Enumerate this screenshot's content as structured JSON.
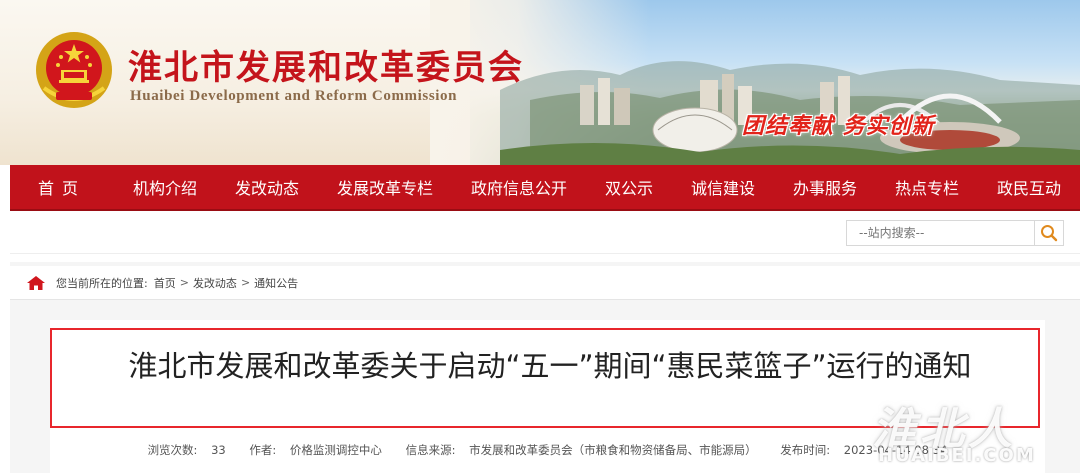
{
  "header": {
    "title_cn": "淮北市发展和改革委员会",
    "title_en": "Huaibei Development and Reform Commission",
    "slogan": "团结奉献  务实创新"
  },
  "nav": {
    "items": [
      {
        "label": "首页"
      },
      {
        "label": "机构介绍"
      },
      {
        "label": "发改动态"
      },
      {
        "label": "发展改革专栏"
      },
      {
        "label": "政府信息公开"
      },
      {
        "label": "双公示"
      },
      {
        "label": "诚信建设"
      },
      {
        "label": "办事服务"
      },
      {
        "label": "热点专栏"
      },
      {
        "label": "政民互动"
      }
    ]
  },
  "search": {
    "placeholder": "--站内搜索--"
  },
  "breadcrumb": {
    "prefix": "您当前所在的位置:",
    "items": [
      "首页",
      "发改动态",
      "通知公告"
    ],
    "separator": ">"
  },
  "article": {
    "title": "淮北市发展和改革委关于启动“五一”期间“惠民菜篮子”运行的通知",
    "meta": {
      "views_label": "浏览次数:",
      "views": "33",
      "author_label": "作者:",
      "author": "价格监测调控中心",
      "source_label": "信息来源:",
      "source": "市发展和改革委员会（市粮食和物资储备局、市能源局）",
      "date_label": "发布时间:",
      "date": "2023-04-14 08:34"
    }
  },
  "watermark": {
    "cn": "淮北人",
    "en": "HUAIBEI.COM"
  },
  "colors": {
    "brand_red": "#c1121b",
    "title_red": "#c4141b",
    "highlight_border": "#e8262c",
    "search_icon": "#e08a1e"
  }
}
